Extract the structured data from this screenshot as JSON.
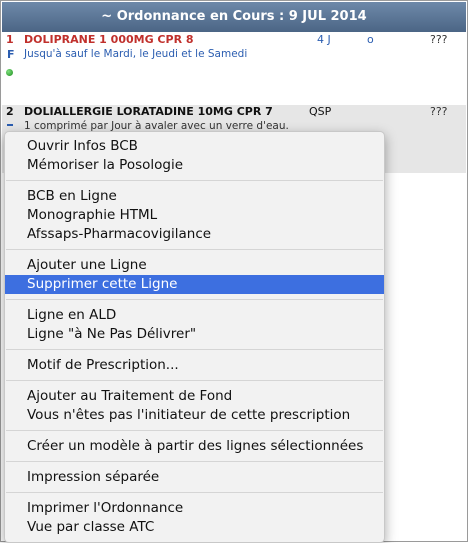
{
  "header": {
    "title": "~ Ordonnance en Cours : 9 JUL 2014"
  },
  "rows": [
    {
      "number": "1",
      "name": "DOLIPRANE 1 000MG CPR 8",
      "duration": "4 J",
      "flag": "o",
      "qty": "???",
      "marker": "F",
      "posology": "Jusqu'à  sauf le Mardi, le Jeudi et le Samedi"
    },
    {
      "number": "2",
      "name": "DOLIALLERGIE LORATADINE 10MG CPR 7",
      "duration": "QSP",
      "qty": "???",
      "posology": "1 comprimé par Jour à avaler avec un verre d'eau."
    }
  ],
  "context_menu": {
    "items": [
      "Ouvrir Infos BCB",
      "Mémoriser la Posologie",
      "BCB en Ligne",
      "Monographie HTML",
      "Afssaps-Pharmacovigilance",
      "Ajouter une Ligne",
      "Supprimer cette Ligne",
      "Ligne en ALD",
      "Ligne \"à Ne Pas Délivrer\"",
      "Motif de Prescription...",
      "Ajouter au Traitement de Fond",
      "Vous n'êtes pas l'initiateur de cette prescription",
      "Créer un modèle à partir des lignes sélectionnées",
      "Impression séparée",
      "Imprimer l'Ordonnance",
      "Vue par classe ATC"
    ],
    "selected": "Supprimer cette Ligne"
  }
}
